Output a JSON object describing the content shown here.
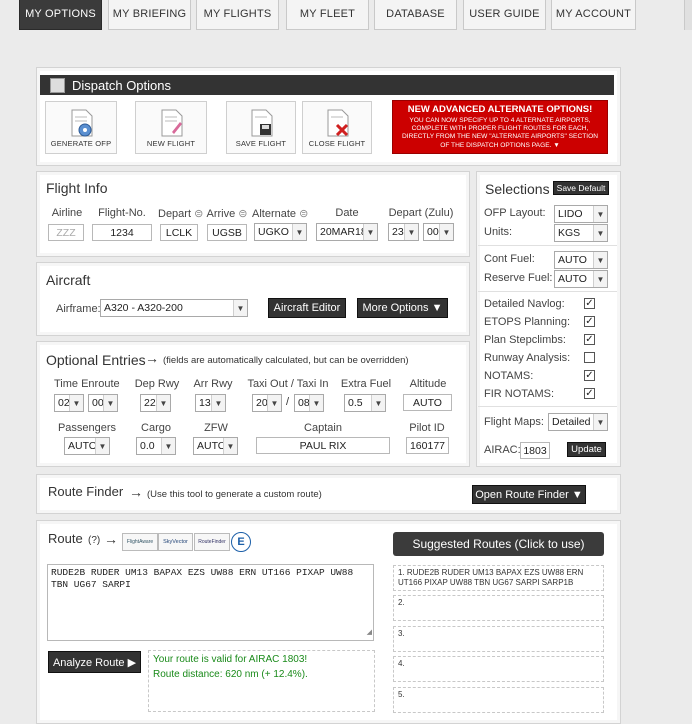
{
  "nav": {
    "tabs": [
      "MY OPTIONS",
      "MY BRIEFING",
      "MY FLIGHTS",
      "MY FLEET",
      "DATABASE",
      "USER GUIDE",
      "MY ACCOUNT"
    ]
  },
  "dispatch": {
    "title": "Dispatch Options",
    "buttons": [
      "GENERATE OFP",
      "NEW FLIGHT",
      "SAVE FLIGHT",
      "CLOSE FLIGHT"
    ],
    "alert_title": "NEW ADVANCED ALTERNATE OPTIONS!",
    "alert_text": "YOU CAN NOW SPECIFY UP TO 4 ALTERNATE AIRPORTS, COMPLETE WITH PROPER FLIGHT ROUTES FOR EACH, DIRECTLY FROM THE NEW \"ALTERNATE AIRPORTS\" SECTION OF THE DISPATCH OPTIONS PAGE. ▼"
  },
  "flight_info": {
    "title": "Flight Info",
    "labels": {
      "airline": "Airline",
      "flight_no": "Flight-No.",
      "depart": "Depart",
      "arrive": "Arrive",
      "alternate": "Alternate",
      "date": "Date",
      "depart_zulu": "Depart (Zulu)"
    },
    "airline_placeholder": "ZZZ",
    "flight_no": "1234",
    "depart": "LCLK",
    "arrive": "UGSB",
    "alternate": "UGKO",
    "date": "20MAR18",
    "dep_hour": "23",
    "dep_min": "00"
  },
  "aircraft": {
    "title": "Aircraft",
    "airframe_label": "Airframe:",
    "airframe": "A320 - A320-200",
    "editor_button": "Aircraft Editor",
    "more_button": "More Options ▼"
  },
  "optional": {
    "title": "Optional Entries",
    "note": "(fields are automatically calculated, but can be overridden)",
    "labels": {
      "time_enroute": "Time Enroute",
      "dep_rwy": "Dep Rwy",
      "arr_rwy": "Arr Rwy",
      "taxi": "Taxi Out / Taxi In",
      "extra_fuel": "Extra Fuel",
      "altitude": "Altitude",
      "passengers": "Passengers",
      "cargo": "Cargo",
      "zfw": "ZFW",
      "captain": "Captain",
      "pilot_id": "Pilot ID"
    },
    "enroute_h": "02",
    "enroute_m": "00",
    "dep_rwy": "22",
    "arr_rwy": "13",
    "taxi_out": "20",
    "taxi_sep": "/",
    "taxi_in": "08",
    "extra_fuel": "0.5",
    "altitude": "AUTO",
    "passengers": "AUTO",
    "cargo": "0.0",
    "zfw": "AUTO",
    "captain": "PAUL RIX",
    "pilot_id": "160177"
  },
  "selections": {
    "title": "Selections",
    "save_default": "Save Default",
    "ofp_layout_label": "OFP Layout:",
    "ofp_layout": "LIDO",
    "units_label": "Units:",
    "units": "KGS",
    "cont_fuel_label": "Cont Fuel:",
    "cont_fuel": "AUTO",
    "reserve_fuel_label": "Reserve Fuel:",
    "reserve_fuel": "AUTO",
    "checks": [
      {
        "label": "Detailed Navlog:",
        "checked": true
      },
      {
        "label": "ETOPS Planning:",
        "checked": true
      },
      {
        "label": "Plan Stepclimbs:",
        "checked": true
      },
      {
        "label": "Runway Analysis:",
        "checked": false
      },
      {
        "label": "NOTAMS:",
        "checked": true
      },
      {
        "label": "FIR NOTAMS:",
        "checked": true
      }
    ],
    "flight_maps_label": "Flight Maps:",
    "flight_maps": "Detailed",
    "airac_label": "AIRAC:",
    "airac": "1803",
    "update": "Update"
  },
  "route_finder": {
    "title": "Route Finder",
    "note": "(Use this tool to generate a custom route)",
    "button": "Open Route Finder ▼"
  },
  "route": {
    "title": "Route",
    "help": "(?)",
    "logos": [
      "FlightAware",
      "SkyVector",
      "RouteFinder",
      "E"
    ],
    "text": "RUDE2B RUDER UM13 BAPAX EZS UW88 ERN UT166 PIXAP UW88 TBN UG67 SARPI",
    "analyze_button": "Analyze Route ▶",
    "valid_msg": "Your route is valid for AIRAC 1803!",
    "distance_msg": "Route distance: 620 nm (+ 12.4%).",
    "suggested_title": "Suggested Routes (Click to use)",
    "suggested": [
      {
        "num": "1.",
        "text": "RUDE2B RUDER UM13 BAPAX EZS UW88 ERN UT166 PIXAP UW88 TBN UG67 SARPI SARP1B"
      },
      {
        "num": "2.",
        "text": ""
      },
      {
        "num": "3.",
        "text": ""
      },
      {
        "num": "4.",
        "text": ""
      },
      {
        "num": "5.",
        "text": ""
      }
    ]
  },
  "colors": {
    "dark": "#3b3b3b",
    "alert_red": "#cc0000",
    "valid_green": "#1a8a1a",
    "page_bg": "#ebebeb"
  }
}
